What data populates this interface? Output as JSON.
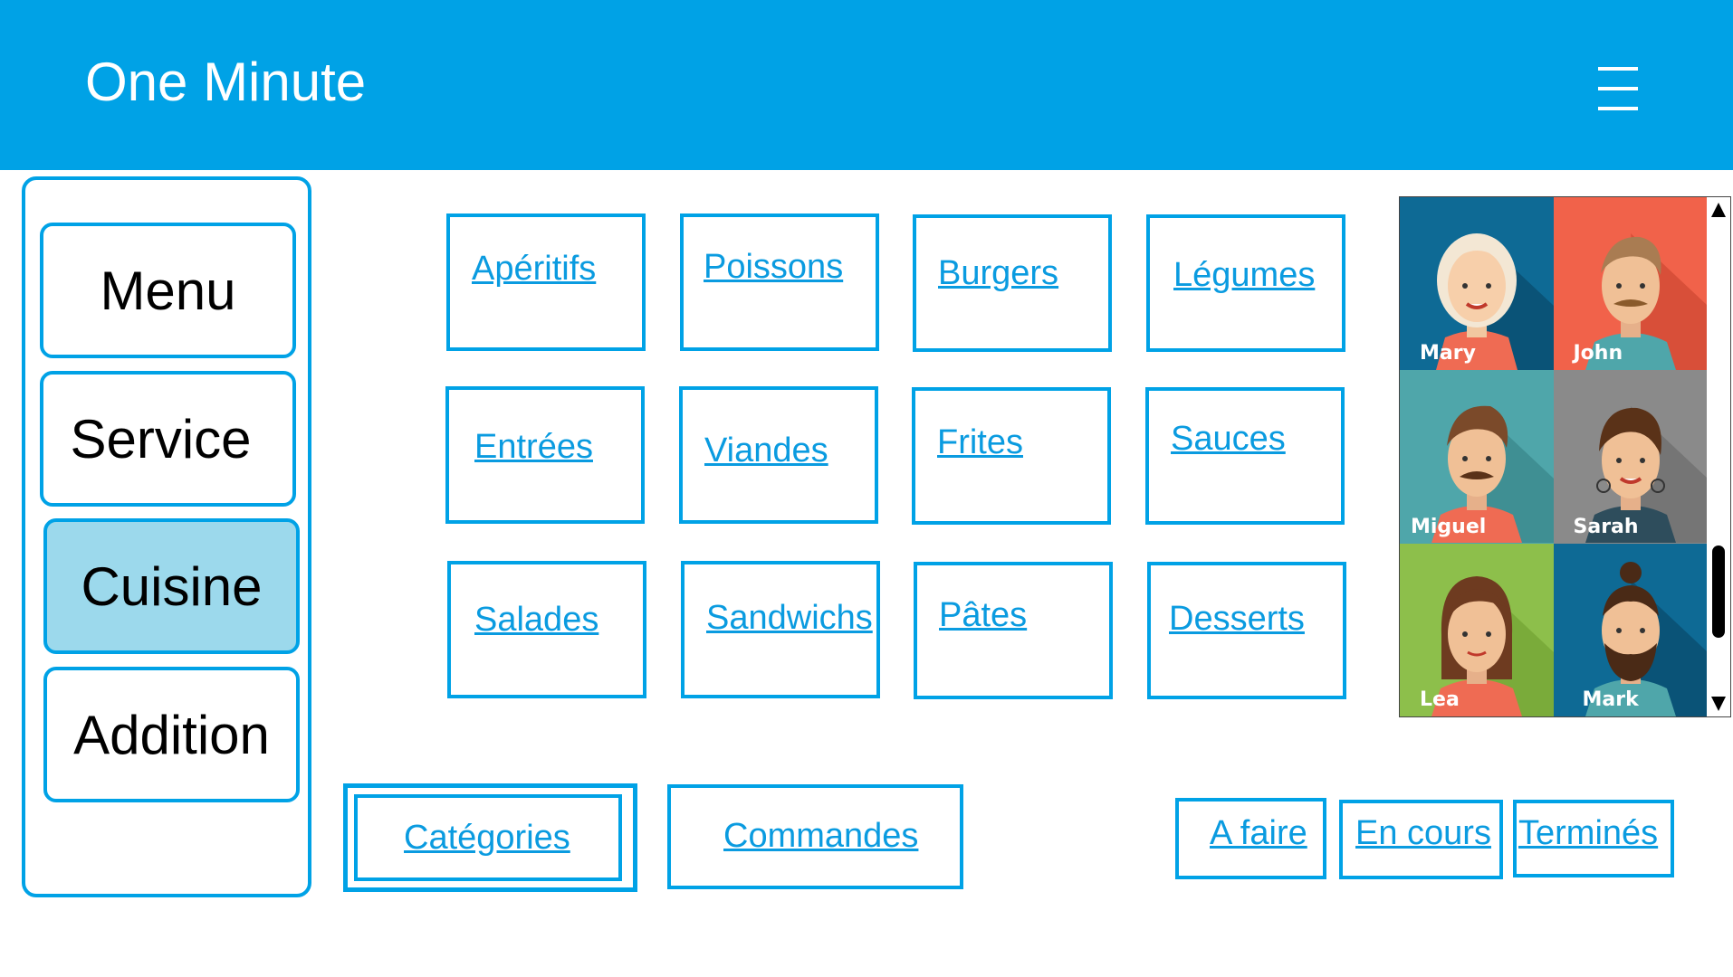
{
  "header": {
    "title": "One Minute",
    "menu_icon": "hamburger-icon",
    "background_color": "#00a2e6"
  },
  "sidebar": {
    "items": [
      {
        "label": "Menu",
        "active": false
      },
      {
        "label": "Service",
        "active": false
      },
      {
        "label": "Cuisine",
        "active": true
      },
      {
        "label": "Addition",
        "active": false
      }
    ]
  },
  "categories": [
    "Apéritifs",
    "Poissons",
    "Burgers",
    "Légumes",
    "Entrées",
    "Viandes",
    "Frites",
    "Sauces",
    "Salades",
    "Sandwichs",
    "Pâtes",
    "Desserts"
  ],
  "view_tabs": [
    {
      "label": "Catégories",
      "selected": true
    },
    {
      "label": "Commandes",
      "selected": false
    }
  ],
  "status_filters": [
    "A faire",
    "En cours",
    "Terminés"
  ],
  "staff": [
    {
      "name": "Mary",
      "bg": "#0e6a95"
    },
    {
      "name": "John",
      "bg": "#f1624a"
    },
    {
      "name": "Miguel",
      "bg": "#4fa6aa"
    },
    {
      "name": "Sarah",
      "bg": "#8a8a8a"
    },
    {
      "name": "Lea",
      "bg": "#8dbf4b"
    },
    {
      "name": "Mark",
      "bg": "#0e6a95"
    }
  ],
  "colors": {
    "accent": "#00a2e6",
    "link": "#0a9be0",
    "active_sidebar": "#9cd9ec"
  }
}
